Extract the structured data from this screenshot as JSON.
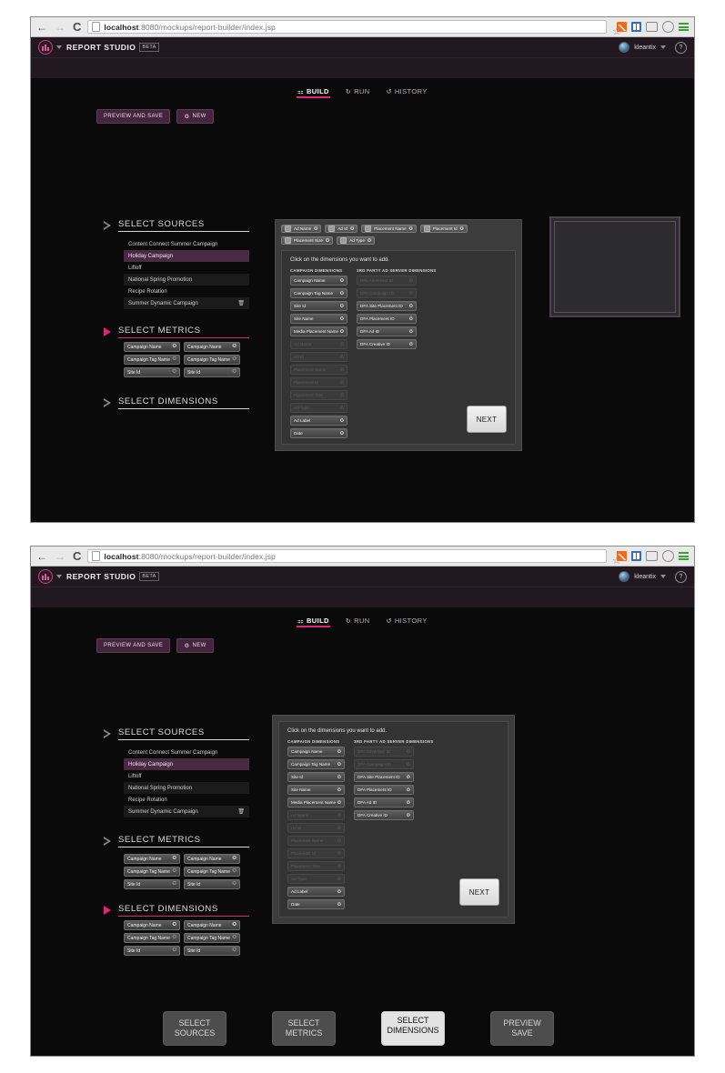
{
  "browser": {
    "back_icon": "←",
    "forward_icon": "→",
    "reload_icon": "C",
    "url_host": "localhost",
    "url_path": ":8080/mockups/report-builder/index.jsp",
    "star_icon": "☆",
    "extension_icons": [
      "chart-extension-icon",
      "bookmarks-extension-icon",
      "screencast-icon",
      "camera-icon",
      "chrome-menu-icon"
    ]
  },
  "app": {
    "brand": "REPORT STUDIO",
    "beta_badge": "BETA",
    "user": "kleantix",
    "help_icon": "?",
    "tabs": [
      {
        "label": "BUILD",
        "icon": "⚏",
        "active": true
      },
      {
        "label": "RUN",
        "icon": "↻",
        "active": false
      },
      {
        "label": "HISTORY",
        "icon": "↺",
        "active": false
      }
    ],
    "actions": [
      {
        "label": "PREVIEW AND SAVE",
        "icon": ""
      },
      {
        "label": "NEW",
        "icon": "⚙"
      }
    ],
    "sections": {
      "sources": {
        "title": "SELECT SOURCES",
        "expanded": true,
        "items": [
          {
            "label": "Content Connect Summer Campaign",
            "selected": false,
            "alt": false,
            "trash": false
          },
          {
            "label": "Holiday Campaign",
            "selected": true,
            "alt": false,
            "trash": false
          },
          {
            "label": "Liftoff",
            "selected": false,
            "alt": false,
            "trash": false
          },
          {
            "label": "National Spring Promotion",
            "selected": false,
            "alt": true,
            "trash": false
          },
          {
            "label": "Recipe Rotation",
            "selected": false,
            "alt": false,
            "trash": false
          },
          {
            "label": "Summer Dynamic Campaign",
            "selected": false,
            "alt": true,
            "trash": true,
            "trash_icon": "🗑"
          }
        ]
      },
      "metrics": {
        "title": "SELECT METRICS",
        "expanded": true,
        "chips": [
          {
            "label": "Campaign Name",
            "remove_icon": "✪",
            "dim": false
          },
          {
            "label": "Campaign Name",
            "remove_icon": "✪",
            "dim": false
          },
          {
            "label": "Campaign Tag Name",
            "remove_icon": "✪",
            "dim": true
          },
          {
            "label": "Campaign Tag Name",
            "remove_icon": "✪",
            "dim": true
          },
          {
            "label": "Site Id",
            "remove_icon": "✪",
            "dim": true
          },
          {
            "label": "Site Id",
            "remove_icon": "✪",
            "dim": true
          }
        ]
      },
      "dimensions": {
        "title": "SELECT DIMENSIONS",
        "chips": [
          {
            "label": "Campaign Name",
            "remove_icon": "✪",
            "dim": false
          },
          {
            "label": "Campaign Name",
            "remove_icon": "✪",
            "dim": false
          },
          {
            "label": "Campaign Tag Name",
            "remove_icon": "✪",
            "dim": true
          },
          {
            "label": "Campaign Tag Name",
            "remove_icon": "✪",
            "dim": true
          },
          {
            "label": "Site Id",
            "remove_icon": "✪",
            "dim": true
          },
          {
            "label": "Site Id",
            "remove_icon": "✪",
            "dim": true
          }
        ]
      }
    },
    "selected_chips": [
      {
        "label": "Ad Name",
        "remove_icon": "✪"
      },
      {
        "label": "Ad Id",
        "remove_icon": "✪"
      },
      {
        "label": "Placement Name",
        "remove_icon": "✪"
      },
      {
        "label": "Placement Id",
        "remove_icon": "✪"
      },
      {
        "label": "Placement Size",
        "remove_icon": "✪"
      },
      {
        "label": "Ad Type",
        "remove_icon": "✪"
      }
    ],
    "dimension_picker": {
      "hint": "Click on the dimensions you want to add.",
      "columns": [
        {
          "heading": "CAMPAIGN DIMENSIONS",
          "items": [
            {
              "label": "Campaign Name",
              "disabled": false
            },
            {
              "label": "Campaign Tag Name",
              "disabled": false
            },
            {
              "label": "Site Id",
              "disabled": false
            },
            {
              "label": "Site Name",
              "disabled": false
            },
            {
              "label": "Media Placement Name",
              "disabled": false
            },
            {
              "label": "Ad Name",
              "disabled": true
            },
            {
              "label": "Ad Id",
              "disabled": true
            },
            {
              "label": "Placement Name",
              "disabled": true
            },
            {
              "label": "Placement Id",
              "disabled": true
            },
            {
              "label": "Placement Size",
              "disabled": true
            },
            {
              "label": "Ad Type",
              "disabled": true
            },
            {
              "label": "Ad Label",
              "disabled": false
            },
            {
              "label": "Date",
              "disabled": false
            }
          ]
        },
        {
          "heading": "3RD PARTY AD SERVER DIMENSIONS",
          "items": [
            {
              "label": "DFA Advertiser ID",
              "disabled": true
            },
            {
              "label": "DFA Campaign ID",
              "disabled": true
            },
            {
              "label": "DFA Site Placement ID",
              "disabled": false
            },
            {
              "label": "DFA Placement ID",
              "disabled": false
            },
            {
              "label": "DFA Ad ID",
              "disabled": false
            },
            {
              "label": "DFA Creative ID",
              "disabled": false
            }
          ]
        }
      ],
      "next_label": "NEXT"
    },
    "bottom_nav": [
      {
        "label": "SELECT SOURCES",
        "active": false
      },
      {
        "label": "SELECT METRICS",
        "active": false
      },
      {
        "label": "SELECT DIMENSIONS",
        "active": true
      },
      {
        "label": "PREVIEW SAVE",
        "active": false
      }
    ]
  },
  "colors": {
    "accent_pink": "#e0247e",
    "header_purple": "#221820",
    "selected_source": "#4a2a43",
    "app_background": "#0a0a0a"
  }
}
